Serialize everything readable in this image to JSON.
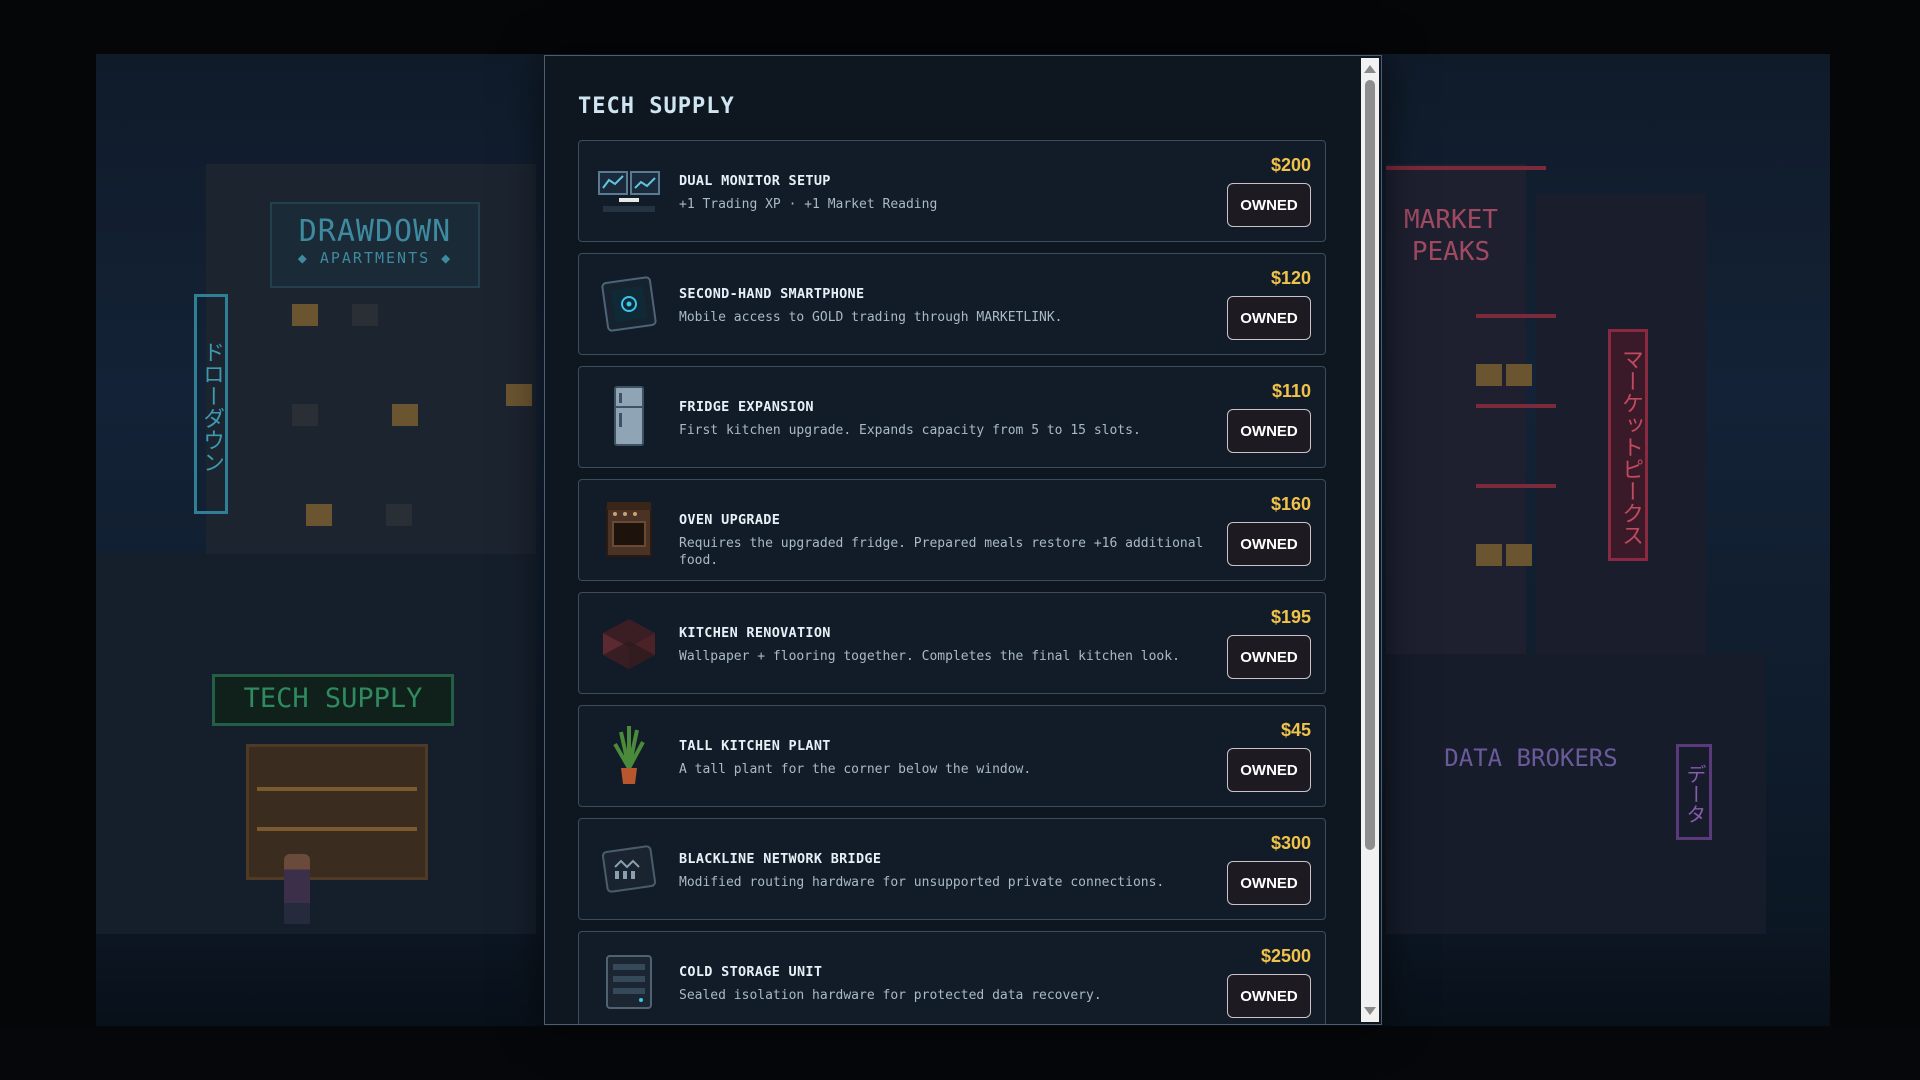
{
  "background": {
    "signs": {
      "drawdown_title": "DRAWDOWN",
      "drawdown_subtitle": "◆ APARTMENTS ◆",
      "drawdown_vertical": "ドローダウン",
      "tech_supply": "TECH SUPPLY",
      "market_peaks": "MARKET PEAKS",
      "market_vertical": "マーケットピークス",
      "data_brokers": "DATA BROKERS",
      "data_vertical": "データ"
    }
  },
  "modal": {
    "title": "TECH SUPPLY",
    "items": [
      {
        "icon": "dual-monitor-icon",
        "name": "DUAL MONITOR SETUP",
        "desc": "+1 Trading XP · +1 Market Reading",
        "price": "$200",
        "status": "OWNED"
      },
      {
        "icon": "smartphone-icon",
        "name": "SECOND-HAND SMARTPHONE",
        "desc": "Mobile access to GOLD trading through MARKETLINK.",
        "price": "$120",
        "status": "OWNED"
      },
      {
        "icon": "fridge-icon",
        "name": "FRIDGE EXPANSION",
        "desc": "First kitchen upgrade. Expands capacity from 5 to 15 slots.",
        "price": "$110",
        "status": "OWNED"
      },
      {
        "icon": "oven-icon",
        "name": "OVEN UPGRADE",
        "desc": "Requires the upgraded fridge. Prepared meals restore +16 additional food.",
        "price": "$160",
        "status": "OWNED"
      },
      {
        "icon": "kitchen-room-icon",
        "name": "KITCHEN RENOVATION",
        "desc": "Wallpaper + flooring together. Completes the final kitchen look.",
        "price": "$195",
        "status": "OWNED"
      },
      {
        "icon": "plant-icon",
        "name": "TALL KITCHEN PLANT",
        "desc": "A tall plant for the corner below the window.",
        "price": "$45",
        "status": "OWNED"
      },
      {
        "icon": "network-bridge-icon",
        "name": "BLACKLINE NETWORK BRIDGE",
        "desc": "Modified routing hardware for unsupported private connections.",
        "price": "$300",
        "status": "OWNED"
      },
      {
        "icon": "cold-storage-icon",
        "name": "COLD STORAGE UNIT",
        "desc": "Sealed isolation hardware for protected data recovery.",
        "price": "$2500",
        "status": "OWNED"
      }
    ]
  },
  "colors": {
    "price": "#f0c24a",
    "panel": "#0e1620",
    "title": "#cfe6f2"
  }
}
